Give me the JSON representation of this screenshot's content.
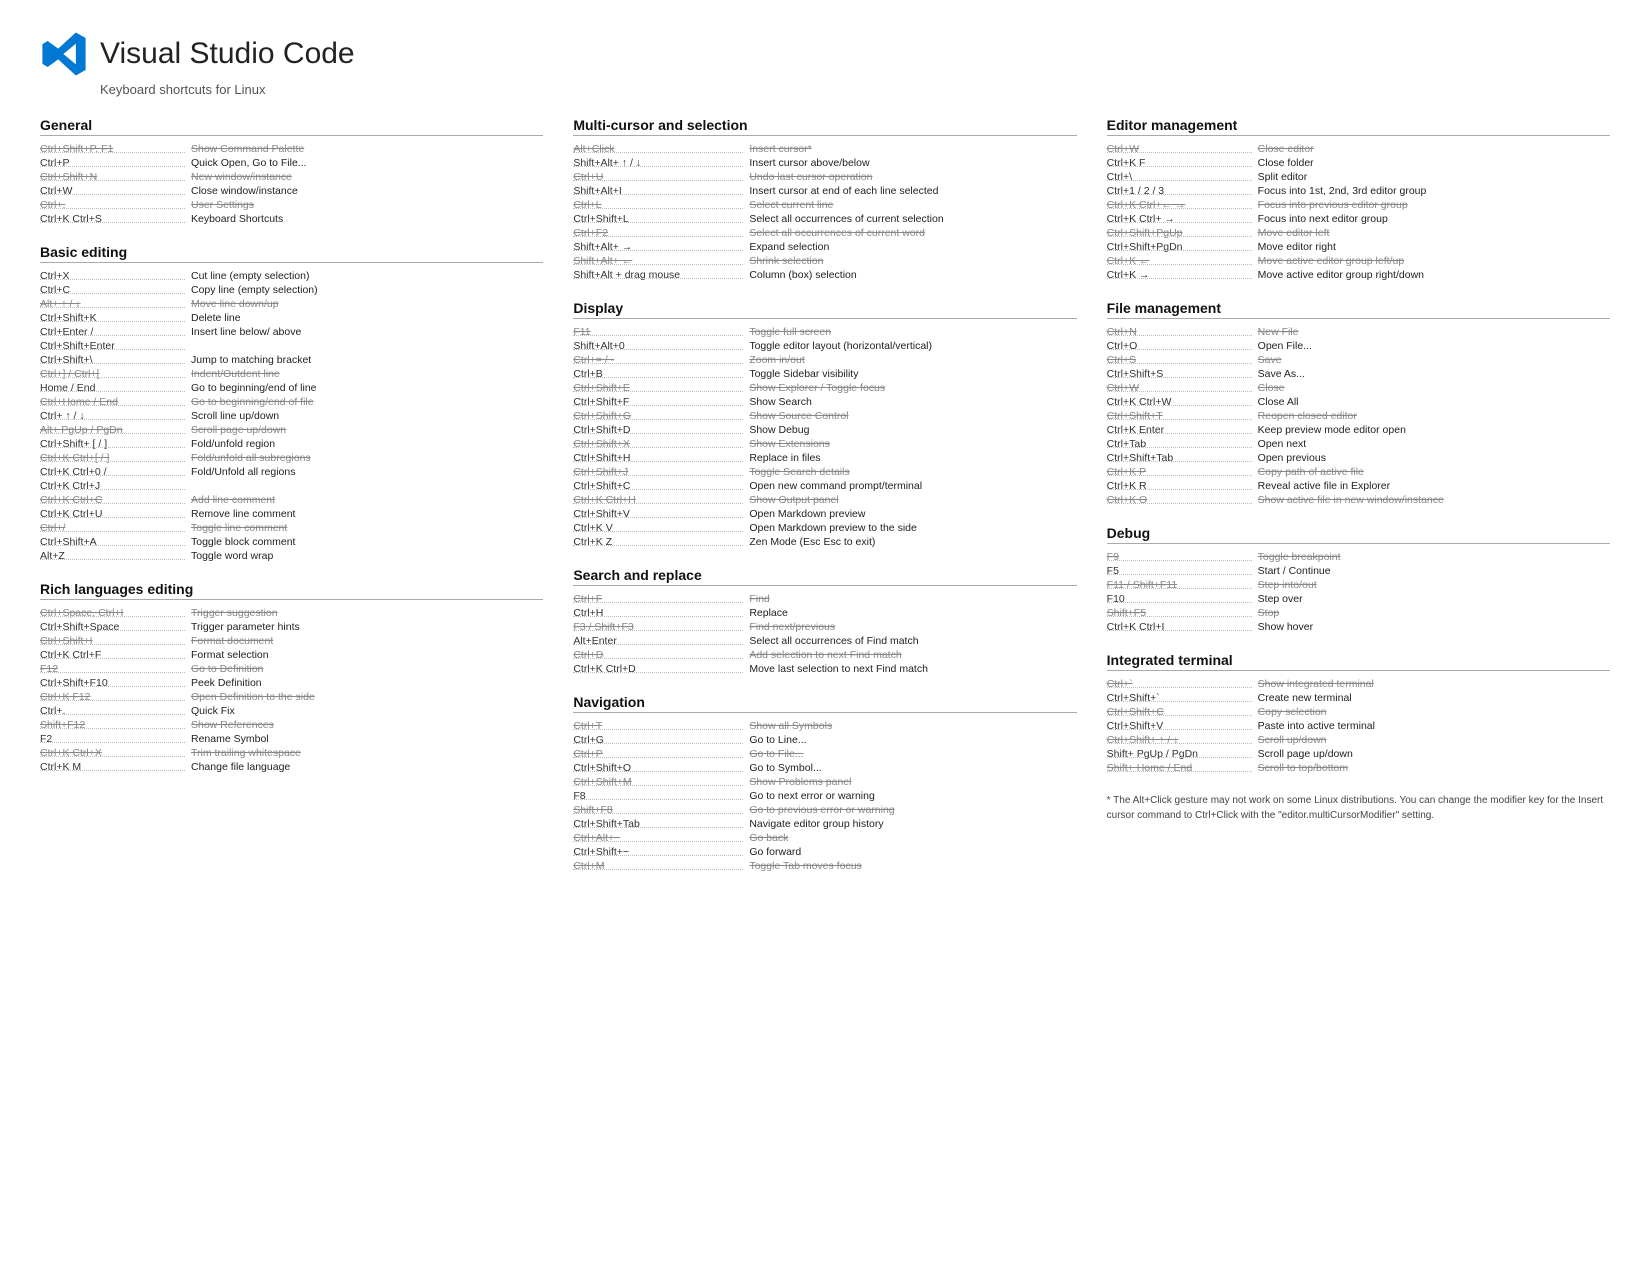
{
  "header": {
    "title": "Visual Studio Code",
    "subtitle": "Keyboard shortcuts for Linux"
  },
  "sections": {
    "col1": [
      {
        "id": "general",
        "title": "General",
        "shortcuts": [
          {
            "key": "Ctrl+Shift+P, F1",
            "desc": "Show Command Palette",
            "strike": true
          },
          {
            "key": "Ctrl+P",
            "desc": "Quick Open, Go to File...",
            "strike": false
          },
          {
            "key": "Ctrl+Shift+N",
            "desc": "New window/instance",
            "strike": true
          },
          {
            "key": "Ctrl+W",
            "desc": "Close window/instance",
            "strike": false
          },
          {
            "key": "Ctrl+,",
            "desc": "User Settings",
            "strike": true
          },
          {
            "key": "Ctrl+K Ctrl+S",
            "desc": "Keyboard Shortcuts",
            "strike": false
          }
        ]
      },
      {
        "id": "basic-editing",
        "title": "Basic editing",
        "shortcuts": [
          {
            "key": "Ctrl+X",
            "desc": "Cut line (empty selection)",
            "strike": false
          },
          {
            "key": "Ctrl+C",
            "desc": "Copy line (empty selection)",
            "strike": false
          },
          {
            "key": "Alt+ ↑ / ↓",
            "desc": "Move line down/up",
            "strike": true
          },
          {
            "key": "Ctrl+Shift+K",
            "desc": "Delete line",
            "strike": false
          },
          {
            "key": "Ctrl+Enter /",
            "desc": "Insert line below/ above",
            "strike": false
          },
          {
            "key": "Ctrl+Shift+Enter",
            "desc": "",
            "strike": false
          },
          {
            "key": "Ctrl+Shift+\\",
            "desc": "Jump to matching bracket",
            "strike": false
          },
          {
            "key": "Ctrl+] / Ctrl+[",
            "desc": "Indent/Outdent line",
            "strike": true
          },
          {
            "key": "Home / End",
            "desc": "Go to beginning/end of line",
            "strike": false
          },
          {
            "key": "Ctrl+Home / End",
            "desc": "Go to beginning/end of file",
            "strike": true
          },
          {
            "key": "Ctrl+ ↑ / ↓",
            "desc": "Scroll line up/down",
            "strike": false
          },
          {
            "key": "Alt+ PgUp / PgDn",
            "desc": "Scroll page up/down",
            "strike": true
          },
          {
            "key": "Ctrl+Shift+ [ / ]",
            "desc": "Fold/unfold region",
            "strike": false
          },
          {
            "key": "Ctrl+K Ctrl+[ / ]",
            "desc": "Fold/unfold all subregions",
            "strike": true
          },
          {
            "key": "Ctrl+K Ctrl+0 /",
            "desc": "Fold/Unfold all regions",
            "strike": false
          },
          {
            "key": "Ctrl+K Ctrl+J",
            "desc": "",
            "strike": false
          },
          {
            "key": "Ctrl+K Ctrl+C",
            "desc": "Add line comment",
            "strike": true
          },
          {
            "key": "Ctrl+K Ctrl+U",
            "desc": "Remove line comment",
            "strike": false
          },
          {
            "key": "Ctrl+/",
            "desc": "Toggle line comment",
            "strike": true
          },
          {
            "key": "Ctrl+Shift+A",
            "desc": "Toggle block comment",
            "strike": false
          },
          {
            "key": "Alt+Z",
            "desc": "Toggle word wrap",
            "strike": false
          }
        ]
      },
      {
        "id": "rich-languages",
        "title": "Rich languages editing",
        "shortcuts": [
          {
            "key": "Ctrl+Space, Ctrl+I",
            "desc": "Trigger suggestion",
            "strike": true
          },
          {
            "key": "Ctrl+Shift+Space",
            "desc": "Trigger parameter hints",
            "strike": false
          },
          {
            "key": "Ctrl+Shift+I",
            "desc": "Format document",
            "strike": true
          },
          {
            "key": "Ctrl+K Ctrl+F",
            "desc": "Format selection",
            "strike": false
          },
          {
            "key": "F12",
            "desc": "Go to Definition",
            "strike": true
          },
          {
            "key": "Ctrl+Shift+F10",
            "desc": "Peek Definition",
            "strike": false
          },
          {
            "key": "Ctrl+K F12",
            "desc": "Open Definition to the side",
            "strike": true
          },
          {
            "key": "Ctrl+.",
            "desc": "Quick Fix",
            "strike": false
          },
          {
            "key": "Shift+F12",
            "desc": "Show References",
            "strike": true
          },
          {
            "key": "F2",
            "desc": "Rename Symbol",
            "strike": false
          },
          {
            "key": "Ctrl+K Ctrl+X",
            "desc": "Trim trailing whitespace",
            "strike": true
          },
          {
            "key": "Ctrl+K M",
            "desc": "Change file language",
            "strike": false
          }
        ]
      }
    ],
    "col2": [
      {
        "id": "multi-cursor",
        "title": "Multi-cursor and selection",
        "wide": true,
        "shortcuts": [
          {
            "key": "Alt+Click",
            "desc": "Insert cursor*",
            "strike": true
          },
          {
            "key": "Shift+Alt+ ↑ / ↓",
            "desc": "Insert cursor above/below",
            "strike": false
          },
          {
            "key": "Ctrl+U",
            "desc": "Undo last cursor operation",
            "strike": true
          },
          {
            "key": "Shift+Alt+I",
            "desc": "Insert cursor at end of each line selected",
            "strike": false
          },
          {
            "key": "Ctrl+L",
            "desc": "Select current line",
            "strike": true
          },
          {
            "key": "Ctrl+Shift+L",
            "desc": "Select all occurrences of current selection",
            "strike": false
          },
          {
            "key": "Ctrl+F2",
            "desc": "Select all occurrences of current word",
            "strike": true
          },
          {
            "key": "Shift+Alt+ →",
            "desc": "Expand selection",
            "strike": false
          },
          {
            "key": "Shift+Alt+ ←",
            "desc": "Shrink selection",
            "strike": true
          },
          {
            "key": "Shift+Alt + drag mouse",
            "desc": "Column (box) selection",
            "strike": false
          }
        ]
      },
      {
        "id": "display",
        "title": "Display",
        "wide": true,
        "shortcuts": [
          {
            "key": "F11",
            "desc": "Toggle full screen",
            "strike": true
          },
          {
            "key": "Shift+Alt+0",
            "desc": "Toggle editor layout (horizontal/vertical)",
            "strike": false
          },
          {
            "key": "Ctrl+= / -",
            "desc": "Zoom in/out",
            "strike": true
          },
          {
            "key": "Ctrl+B",
            "desc": "Toggle Sidebar visibility",
            "strike": false
          },
          {
            "key": "Ctrl+Shift+E",
            "desc": "Show Explorer / Toggle focus",
            "strike": true
          },
          {
            "key": "Ctrl+Shift+F",
            "desc": "Show Search",
            "strike": false
          },
          {
            "key": "Ctrl+Shift+G",
            "desc": "Show Source Control",
            "strike": true
          },
          {
            "key": "Ctrl+Shift+D",
            "desc": "Show Debug",
            "strike": false
          },
          {
            "key": "Ctrl+Shift+X",
            "desc": "Show Extensions",
            "strike": true
          },
          {
            "key": "Ctrl+Shift+H",
            "desc": "Replace in files",
            "strike": false
          },
          {
            "key": "Ctrl+Shift+J",
            "desc": "Toggle Search details",
            "strike": true
          },
          {
            "key": "Ctrl+Shift+C",
            "desc": "Open new command prompt/terminal",
            "strike": false
          },
          {
            "key": "Ctrl+K Ctrl+H",
            "desc": "Show Output panel",
            "strike": true
          },
          {
            "key": "Ctrl+Shift+V",
            "desc": "Open Markdown preview",
            "strike": false
          },
          {
            "key": "Ctrl+K V",
            "desc": "Open Markdown preview to the side",
            "strike": false
          },
          {
            "key": "Ctrl+K Z",
            "desc": "Zen Mode (Esc Esc to exit)",
            "strike": false
          }
        ]
      },
      {
        "id": "search-replace",
        "title": "Search and replace",
        "wide": true,
        "shortcuts": [
          {
            "key": "Ctrl+F",
            "desc": "Find",
            "strike": true
          },
          {
            "key": "Ctrl+H",
            "desc": "Replace",
            "strike": false
          },
          {
            "key": "F3 / Shift+F3",
            "desc": "Find next/previous",
            "strike": true
          },
          {
            "key": "Alt+Enter",
            "desc": "Select all occurrences of Find match",
            "strike": false
          },
          {
            "key": "Ctrl+D",
            "desc": "Add selection to next Find match",
            "strike": true
          },
          {
            "key": "Ctrl+K Ctrl+D",
            "desc": "Move last selection to next Find match",
            "strike": false
          }
        ]
      },
      {
        "id": "navigation",
        "title": "Navigation",
        "wide": true,
        "shortcuts": [
          {
            "key": "Ctrl+T",
            "desc": "Show all Symbols",
            "strike": true
          },
          {
            "key": "Ctrl+G",
            "desc": "Go to Line...",
            "strike": false
          },
          {
            "key": "Ctrl+P",
            "desc": "Go to File...",
            "strike": true
          },
          {
            "key": "Ctrl+Shift+O",
            "desc": "Go to Symbol...",
            "strike": false
          },
          {
            "key": "Ctrl+Shift+M",
            "desc": "Show Problems panel",
            "strike": true
          },
          {
            "key": "F8",
            "desc": "Go to next error or warning",
            "strike": false
          },
          {
            "key": "Shift+F8",
            "desc": "Go to previous error or warning",
            "strike": true
          },
          {
            "key": "Ctrl+Shift+Tab",
            "desc": "Navigate editor group history",
            "strike": false
          },
          {
            "key": "Ctrl+Alt+−",
            "desc": "Go back",
            "strike": true
          },
          {
            "key": "Ctrl+Shift+−",
            "desc": "Go forward",
            "strike": false
          },
          {
            "key": "Ctrl+M",
            "desc": "Toggle Tab moves focus",
            "strike": true
          }
        ]
      }
    ],
    "col3": [
      {
        "id": "editor-management",
        "title": "Editor management",
        "shortcuts": [
          {
            "key": "Ctrl+W",
            "desc": "Close editor",
            "strike": true
          },
          {
            "key": "Ctrl+K F",
            "desc": "Close folder",
            "strike": false
          },
          {
            "key": "Ctrl+\\",
            "desc": "Split editor",
            "strike": false
          },
          {
            "key": "Ctrl+1 / 2 / 3",
            "desc": "Focus into 1st, 2nd, 3rd editor group",
            "strike": false
          },
          {
            "key": "Ctrl+K Ctrl+← →",
            "desc": "Focus into previous editor group",
            "strike": true
          },
          {
            "key": "Ctrl+K Ctrl+ →",
            "desc": "Focus into next editor group",
            "strike": false
          },
          {
            "key": "Ctrl+Shift+PgUp",
            "desc": "Move editor left",
            "strike": true
          },
          {
            "key": "Ctrl+Shift+PgDn",
            "desc": "Move editor right",
            "strike": false
          },
          {
            "key": "Ctrl+K ←",
            "desc": "Move active editor group left/up",
            "strike": true
          },
          {
            "key": "Ctrl+K →",
            "desc": "Move active editor group right/down",
            "strike": false
          }
        ]
      },
      {
        "id": "file-management",
        "title": "File management",
        "shortcuts": [
          {
            "key": "Ctrl+N",
            "desc": "New File",
            "strike": true
          },
          {
            "key": "Ctrl+O",
            "desc": "Open File...",
            "strike": false
          },
          {
            "key": "Ctrl+S",
            "desc": "Save",
            "strike": true
          },
          {
            "key": "Ctrl+Shift+S",
            "desc": "Save As...",
            "strike": false
          },
          {
            "key": "Ctrl+W",
            "desc": "Close",
            "strike": true
          },
          {
            "key": "Ctrl+K Ctrl+W",
            "desc": "Close All",
            "strike": false
          },
          {
            "key": "Ctrl+Shift+T",
            "desc": "Reopen closed editor",
            "strike": true
          },
          {
            "key": "Ctrl+K Enter",
            "desc": "Keep preview mode editor open",
            "strike": false
          },
          {
            "key": "Ctrl+Tab",
            "desc": "Open next",
            "strike": false
          },
          {
            "key": "Ctrl+Shift+Tab",
            "desc": "Open previous",
            "strike": false
          },
          {
            "key": "Ctrl+K P",
            "desc": "Copy path of active file",
            "strike": true
          },
          {
            "key": "Ctrl+K R",
            "desc": "Reveal active file in Explorer",
            "strike": false
          },
          {
            "key": "Ctrl+K O",
            "desc": "Show active file in new window/instance",
            "strike": true
          }
        ]
      },
      {
        "id": "debug",
        "title": "Debug",
        "shortcuts": [
          {
            "key": "F9",
            "desc": "Toggle breakpoint",
            "strike": true
          },
          {
            "key": "F5",
            "desc": "Start / Continue",
            "strike": false
          },
          {
            "key": "F11 / Shift+F11",
            "desc": "Step into/out",
            "strike": true
          },
          {
            "key": "F10",
            "desc": "Step over",
            "strike": false
          },
          {
            "key": "Shift+F5",
            "desc": "Stop",
            "strike": true
          },
          {
            "key": "Ctrl+K Ctrl+I",
            "desc": "Show hover",
            "strike": false
          }
        ]
      },
      {
        "id": "integrated-terminal",
        "title": "Integrated terminal",
        "shortcuts": [
          {
            "key": "Ctrl+`",
            "desc": "Show integrated terminal",
            "strike": true
          },
          {
            "key": "Ctrl+Shift+`",
            "desc": "Create new terminal",
            "strike": false
          },
          {
            "key": "Ctrl+Shift+C",
            "desc": "Copy selection",
            "strike": true
          },
          {
            "key": "Ctrl+Shift+V",
            "desc": "Paste into active terminal",
            "strike": false
          },
          {
            "key": "Ctrl+Shift+ ↑ / ↓",
            "desc": "Scroll up/down",
            "strike": true
          },
          {
            "key": "Shift+ PgUp / PgDn",
            "desc": "Scroll page up/down",
            "strike": false
          },
          {
            "key": "Shift+ Home / End",
            "desc": "Scroll to top/bottom",
            "strike": true
          }
        ]
      }
    ]
  },
  "note": "* The Alt+Click gesture may not work on some Linux distributions. You can change the modifier key for the Insert cursor command to Ctrl+Click with the \"editor.multiCursorModifier\" setting."
}
